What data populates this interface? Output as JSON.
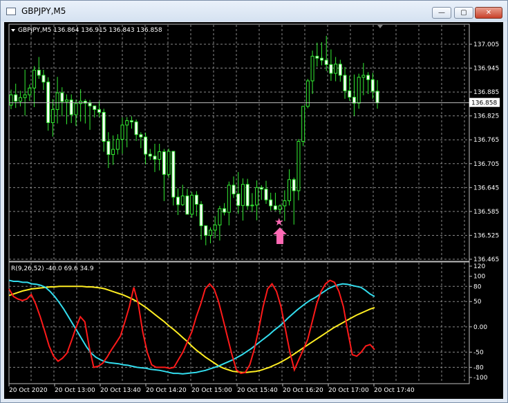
{
  "window": {
    "title": "GBPJPY,M5",
    "minimize": "—",
    "maximize": "▢",
    "close": "✕"
  },
  "main_chart": {
    "header": "GBPJPY,M5  136.864 136.915 136.843 136.858",
    "price_axis": [
      "137.005",
      "136.945",
      "136.885",
      "136.825",
      "136.765",
      "136.705",
      "136.645",
      "136.585",
      "136.525",
      "136.465"
    ],
    "current_price": "136.858",
    "up_color": "#33ee33",
    "bull_body": "#000000",
    "bear_body": "#ffffff",
    "candles": [
      [
        136.852,
        136.891,
        136.842,
        136.878
      ],
      [
        136.878,
        136.906,
        136.845,
        136.862
      ],
      [
        136.862,
        136.888,
        136.849,
        136.871
      ],
      [
        136.871,
        136.941,
        136.826,
        136.878
      ],
      [
        136.878,
        136.904,
        136.862,
        136.895
      ],
      [
        136.895,
        136.95,
        136.847,
        136.94
      ],
      [
        136.94,
        136.973,
        136.918,
        136.927
      ],
      [
        136.927,
        136.941,
        136.89,
        136.91
      ],
      [
        136.91,
        136.922,
        136.788,
        136.808
      ],
      [
        136.808,
        136.867,
        136.773,
        136.841
      ],
      [
        136.841,
        136.923,
        136.806,
        136.883
      ],
      [
        136.883,
        136.897,
        136.824,
        136.861
      ],
      [
        136.861,
        136.879,
        136.804,
        136.865
      ],
      [
        136.865,
        136.879,
        136.807,
        136.828
      ],
      [
        136.828,
        136.866,
        136.8,
        136.856
      ],
      [
        136.856,
        136.892,
        136.811,
        136.862
      ],
      [
        136.862,
        136.867,
        136.806,
        136.857
      ],
      [
        136.857,
        136.865,
        136.79,
        136.85
      ],
      [
        136.85,
        136.851,
        136.821,
        136.841
      ],
      [
        136.841,
        136.862,
        136.822,
        136.834
      ],
      [
        136.834,
        136.843,
        136.735,
        136.761
      ],
      [
        136.761,
        136.784,
        136.694,
        136.728
      ],
      [
        136.728,
        136.776,
        136.702,
        136.741
      ],
      [
        136.741,
        136.779,
        136.728,
        136.766
      ],
      [
        136.766,
        136.821,
        136.73,
        136.802
      ],
      [
        136.802,
        136.822,
        136.746,
        136.813
      ],
      [
        136.813,
        136.824,
        136.793,
        136.81
      ],
      [
        136.81,
        136.816,
        136.762,
        136.778
      ],
      [
        136.778,
        136.784,
        136.744,
        136.772
      ],
      [
        136.772,
        136.783,
        136.703,
        136.729
      ],
      [
        136.729,
        136.742,
        136.714,
        136.724
      ],
      [
        136.724,
        136.755,
        136.684,
        136.716
      ],
      [
        136.716,
        136.755,
        136.688,
        136.735
      ],
      [
        136.735,
        136.742,
        136.611,
        136.678
      ],
      [
        136.678,
        136.743,
        136.669,
        136.736
      ],
      [
        136.736,
        136.737,
        136.6,
        136.621
      ],
      [
        136.621,
        136.643,
        136.576,
        136.602
      ],
      [
        136.602,
        136.652,
        136.599,
        136.624
      ],
      [
        136.624,
        136.642,
        136.577,
        136.578
      ],
      [
        136.578,
        136.634,
        136.569,
        136.626
      ],
      [
        136.626,
        136.636,
        136.573,
        136.603
      ],
      [
        136.603,
        136.611,
        136.514,
        136.549
      ],
      [
        136.549,
        136.55,
        136.5,
        136.525
      ],
      [
        136.525,
        136.545,
        136.505,
        136.538
      ],
      [
        136.538,
        136.573,
        136.518,
        136.551
      ],
      [
        136.551,
        136.599,
        136.512,
        136.592
      ],
      [
        136.592,
        136.606,
        136.575,
        136.583
      ],
      [
        136.583,
        136.66,
        136.55,
        136.651
      ],
      [
        136.651,
        136.673,
        136.619,
        136.629
      ],
      [
        136.629,
        136.684,
        136.579,
        136.6
      ],
      [
        136.6,
        136.668,
        136.562,
        136.653
      ],
      [
        136.653,
        136.667,
        136.589,
        136.599
      ],
      [
        136.599,
        136.631,
        136.583,
        136.601
      ],
      [
        136.601,
        136.663,
        136.563,
        136.645
      ],
      [
        136.645,
        136.651,
        136.614,
        136.641
      ],
      [
        136.641,
        136.662,
        136.604,
        136.614
      ],
      [
        136.614,
        136.632,
        136.587,
        136.599
      ],
      [
        136.599,
        136.632,
        136.587,
        136.59
      ],
      [
        136.59,
        136.603,
        136.578,
        136.599
      ],
      [
        136.599,
        136.638,
        136.561,
        136.612
      ],
      [
        136.612,
        136.691,
        136.6,
        136.665
      ],
      [
        136.665,
        136.67,
        136.552,
        136.637
      ],
      [
        136.637,
        136.767,
        136.613,
        136.761
      ],
      [
        136.761,
        136.849,
        136.749,
        136.849
      ],
      [
        136.849,
        136.918,
        136.844,
        136.913
      ],
      [
        136.913,
        136.989,
        136.88,
        136.975
      ],
      [
        136.975,
        137.009,
        136.949,
        136.97
      ],
      [
        136.97,
        137.01,
        136.952,
        136.965
      ],
      [
        136.965,
        137.026,
        136.938,
        136.954
      ],
      [
        136.954,
        136.992,
        136.913,
        136.932
      ],
      [
        136.932,
        136.973,
        136.912,
        136.955
      ],
      [
        136.955,
        136.966,
        136.911,
        136.927
      ],
      [
        136.927,
        136.948,
        136.868,
        136.888
      ],
      [
        136.888,
        136.926,
        136.863,
        136.872
      ],
      [
        136.872,
        136.929,
        136.825,
        136.857
      ],
      [
        136.857,
        136.931,
        136.843,
        136.922
      ],
      [
        136.922,
        136.958,
        136.877,
        136.927
      ],
      [
        136.927,
        136.935,
        136.88,
        136.916
      ],
      [
        136.916,
        136.933,
        136.868,
        136.887
      ],
      [
        136.887,
        136.915,
        136.843,
        136.858
      ]
    ],
    "marker_star": "★",
    "marker_arrow": "arrow-up",
    "marker_color": "#ff69b4"
  },
  "indicator": {
    "header": "R(9,26,52) -40.0 69.6 34.9",
    "scale": [
      "120",
      "100",
      "80",
      "50",
      "0.00",
      "-50",
      "-80",
      "-100"
    ],
    "levels": [
      80,
      50,
      -50,
      -80
    ],
    "series_colors": {
      "fast": "#ff1a1a",
      "mid": "#33ddee",
      "slow": "#ffee22"
    },
    "fast": [
      75,
      60,
      55,
      52,
      55,
      64,
      45,
      20,
      -8,
      -38,
      -58,
      -68,
      -62,
      -52,
      -28,
      -2,
      20,
      10,
      -40,
      -80,
      -78,
      -72,
      -60,
      -45,
      -32,
      -18,
      10,
      40,
      78,
      45,
      -10,
      -50,
      -75,
      -80,
      -80,
      -80,
      -82,
      -80,
      -65,
      -50,
      -30,
      -10,
      20,
      45,
      75,
      85,
      75,
      50,
      15,
      -20,
      -55,
      -85,
      -92,
      -90,
      -75,
      -45,
      -5,
      40,
      75,
      85,
      70,
      40,
      -5,
      -50,
      -85,
      -65,
      -45,
      -25,
      10,
      45,
      70,
      85,
      92,
      88,
      70,
      40,
      -10,
      -55,
      -58,
      -50,
      -38,
      -35,
      -45
    ],
    "mid": [
      92,
      90,
      90,
      88,
      88,
      85,
      84,
      82,
      78,
      70,
      60,
      48,
      35,
      20,
      5,
      -10,
      -25,
      -40,
      -52,
      -60,
      -65,
      -69,
      -71,
      -72,
      -73,
      -75,
      -76,
      -78,
      -80,
      -81,
      -82,
      -84,
      -85,
      -86,
      -88,
      -90,
      -92,
      -92,
      -93,
      -92,
      -91,
      -90,
      -88,
      -86,
      -83,
      -80,
      -77,
      -73,
      -69,
      -65,
      -60,
      -55,
      -49,
      -43,
      -36,
      -29,
      -22,
      -15,
      -7,
      0,
      8,
      17,
      25,
      33,
      40,
      47,
      53,
      58,
      64,
      70,
      76,
      80,
      83,
      85,
      84,
      82,
      80,
      78,
      72,
      65,
      60
    ],
    "slow": [
      62,
      65,
      68,
      71,
      73,
      75,
      76,
      77,
      78,
      79,
      79,
      80,
      80,
      80,
      80,
      80,
      80,
      79,
      79,
      78,
      77,
      75,
      72,
      69,
      66,
      63,
      59,
      55,
      50,
      44,
      38,
      31,
      24,
      17,
      10,
      2,
      -5,
      -13,
      -21,
      -29,
      -38,
      -46,
      -53,
      -60,
      -66,
      -72,
      -78,
      -82,
      -85,
      -88,
      -89,
      -90,
      -90,
      -89,
      -88,
      -86,
      -83,
      -80,
      -76,
      -72,
      -67,
      -62,
      -56,
      -50,
      -44,
      -38,
      -32,
      -26,
      -20,
      -14,
      -8,
      -2,
      3,
      8,
      13,
      18,
      23,
      27,
      31,
      35,
      38
    ],
    "time_labels": [
      "20 Oct 2020",
      "20 Oct 13:00",
      "20 Oct 13:40",
      "20 Oct 14:20",
      "20 Oct 15:00",
      "20 Oct 15:40",
      "20 Oct 16:20",
      "20 Oct 17:00",
      "20 Oct 17:40"
    ]
  }
}
